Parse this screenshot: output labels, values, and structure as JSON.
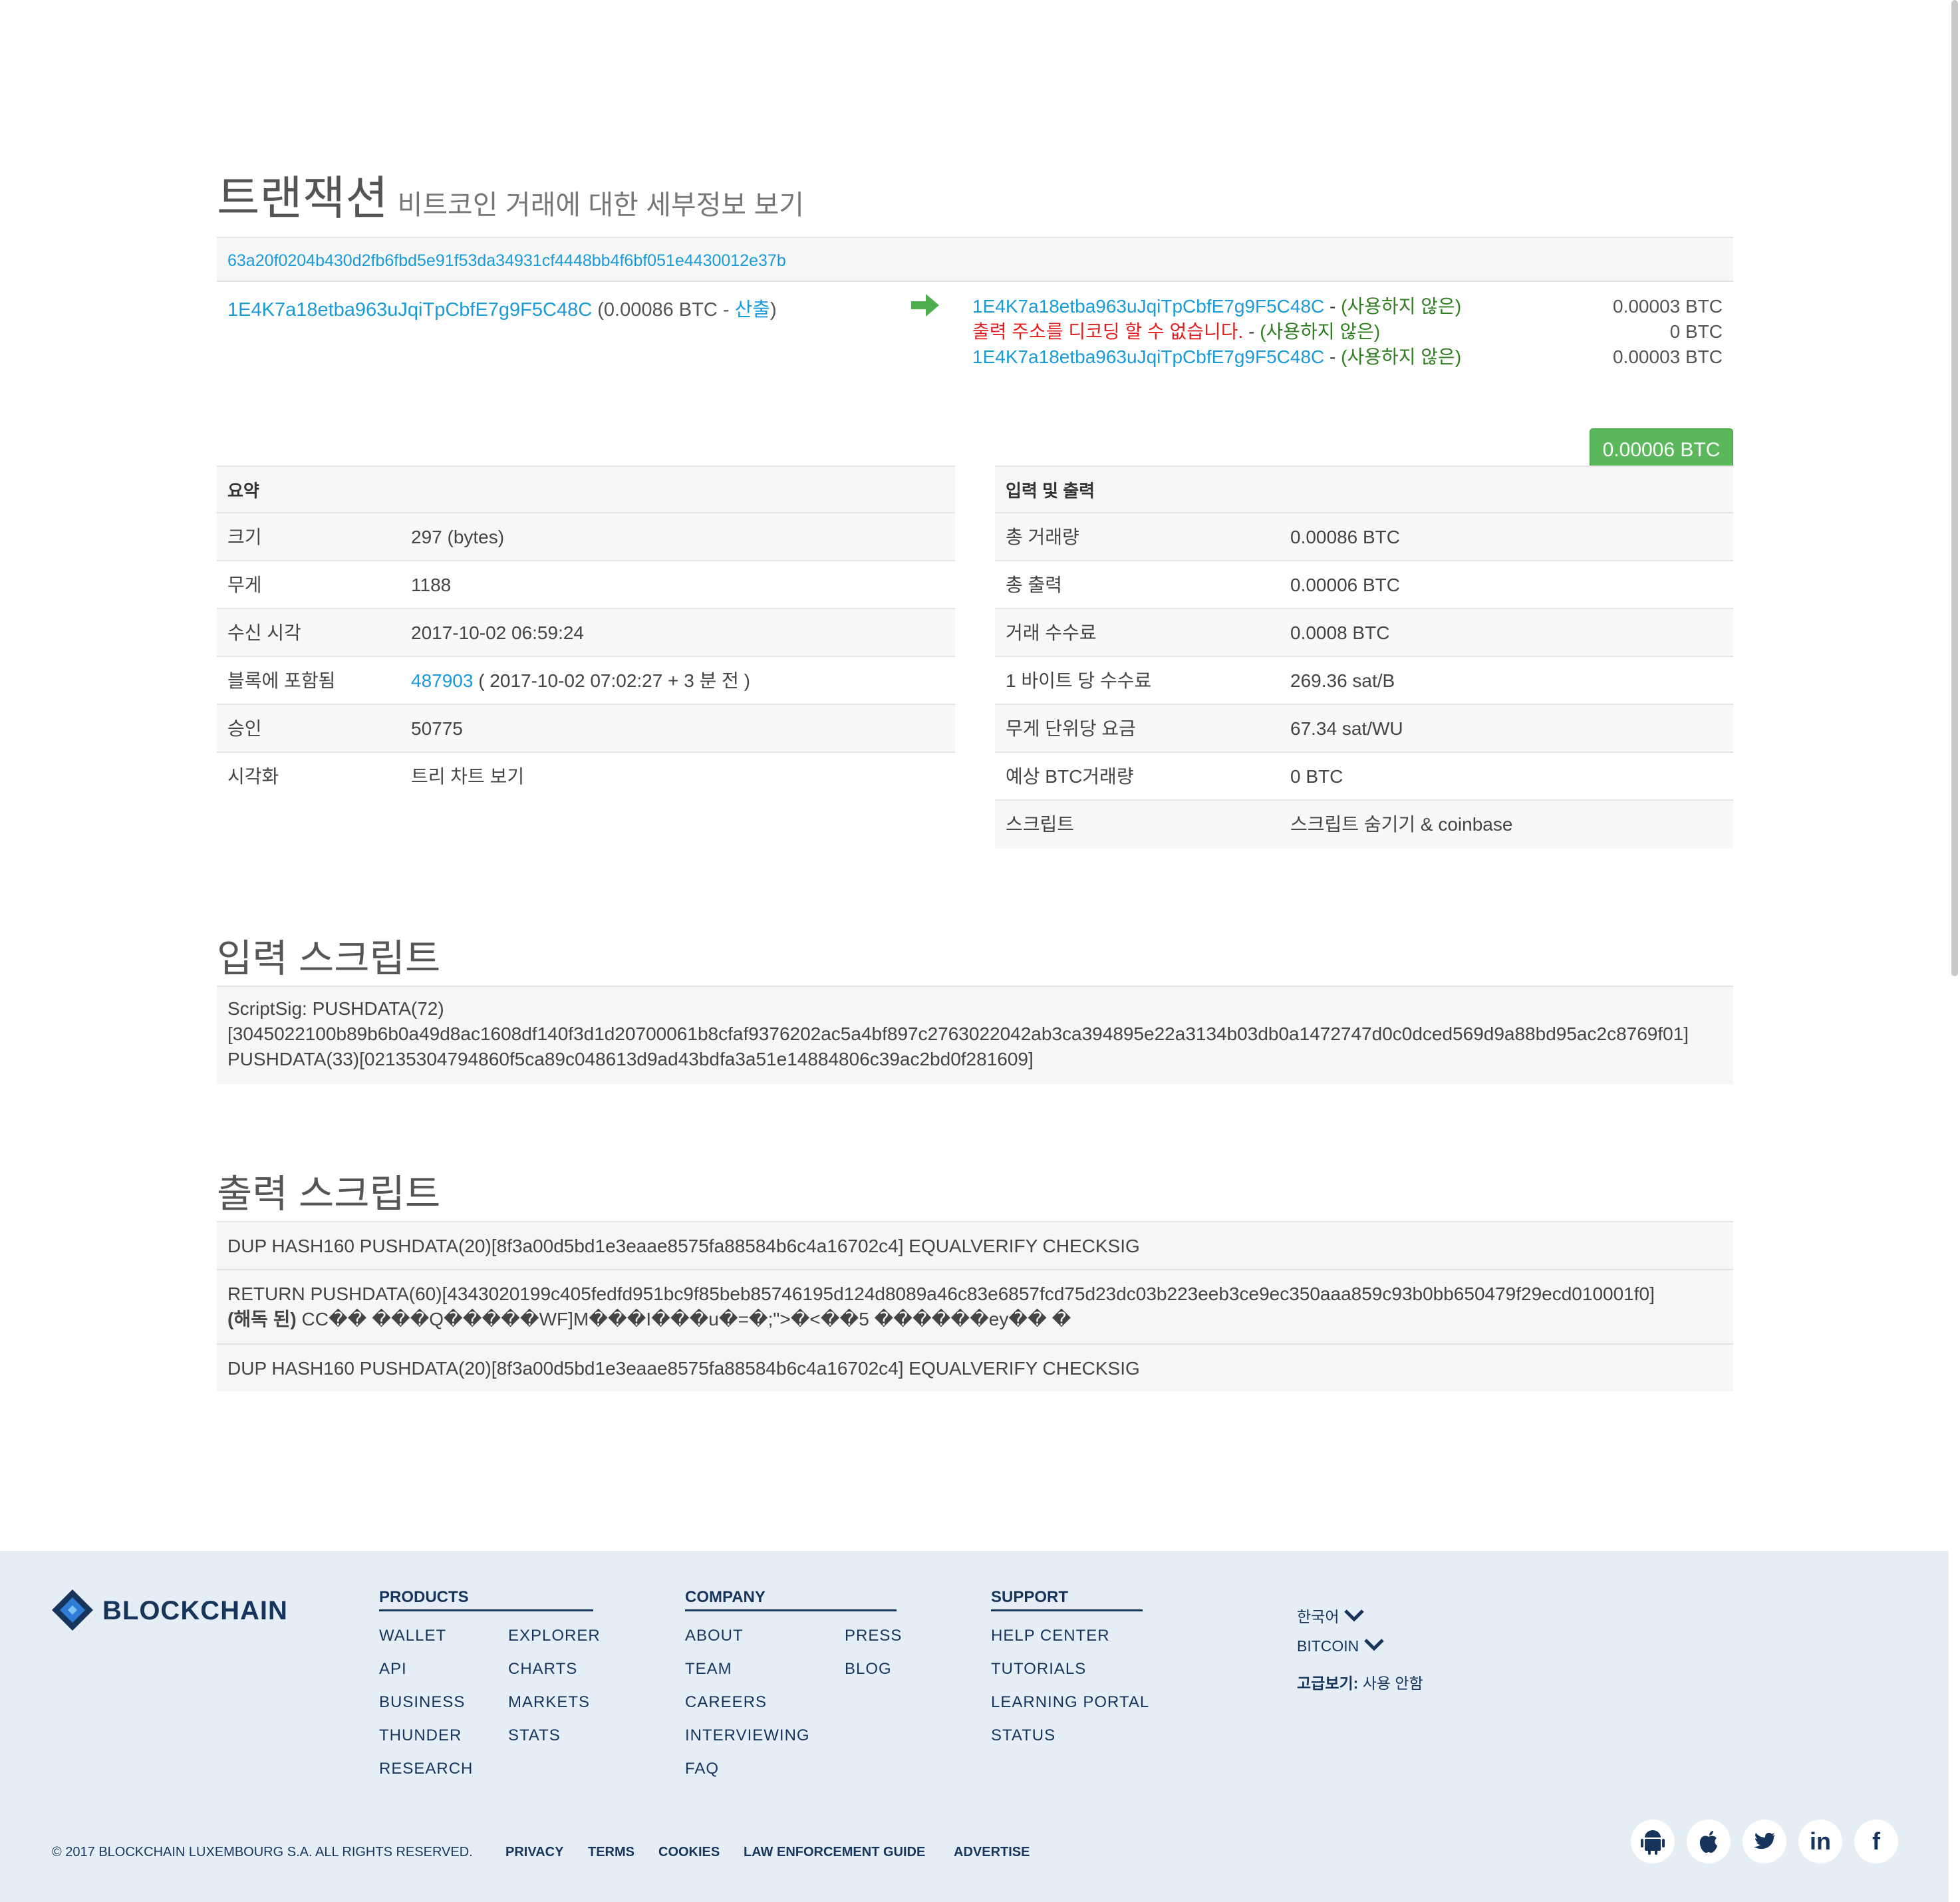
{
  "page": {
    "title": "트랜잭션",
    "subtitle": "비트코인 거래에 대한 세부정보 보기"
  },
  "tx": {
    "hash": "63a20f0204b430d2fb6fbd5e91f53da34931cf4448bb4f6bf051e4430012e37b",
    "input": {
      "address": "1E4K7a18etba963uJqiTpCbfE7g9F5C48C",
      "amount": "(0.00086 BTC - ",
      "spent_label": "산출",
      "close": ")"
    },
    "outputs": [
      {
        "address": "1E4K7a18etba963uJqiTpCbfE7g9F5C48C",
        "sep": " - ",
        "status": "(사용하지 않은)",
        "amount": "0.00003 BTC"
      },
      {
        "address": "출력 주소를 디코딩 할 수 없습니다.",
        "sep": " - ",
        "status": "(사용하지 않은)",
        "amount": "0 BTC"
      },
      {
        "address": "1E4K7a18etba963uJqiTpCbfE7g9F5C48C",
        "sep": " - ",
        "status": "(사용하지 않은)",
        "amount": "0.00003 BTC"
      }
    ],
    "total": "0.00006 BTC",
    "colors": {
      "link": "#1a9bd7",
      "unspent": "#2e7d1f",
      "error": "#e02020",
      "total_button": "#5cb85c"
    }
  },
  "summary": {
    "header": "요약",
    "rows": [
      {
        "label": "크기",
        "value": "297 (bytes)"
      },
      {
        "label": "무게",
        "value": "1188"
      },
      {
        "label": "수신 시각",
        "value": "2017-10-02 06:59:24"
      },
      {
        "label": "블록에 포함됨",
        "block": "487903",
        "value": " ( 2017-10-02 07:02:27 + 3 분 전 )"
      },
      {
        "label": "승인",
        "value": "50775"
      },
      {
        "label": "시각화",
        "value": "트리 차트 보기"
      }
    ]
  },
  "io": {
    "header": "입력 및 출력",
    "rows": [
      {
        "label": "총 거래량",
        "value": "0.00086 BTC"
      },
      {
        "label": "총 출력",
        "value": "0.00006 BTC"
      },
      {
        "label": "거래 수수료",
        "value": "0.0008 BTC"
      },
      {
        "label": "1 바이트 당 수수료",
        "value": "269.36 sat/B"
      },
      {
        "label": "무게 단위당 요금",
        "value": "67.34 sat/WU"
      },
      {
        "label": "예상 BTC거래량",
        "value": "0 BTC"
      },
      {
        "label": "스크립트",
        "value": "스크립트 숨기기 & coinbase"
      }
    ]
  },
  "input_scripts": {
    "title": "입력 스크립트",
    "lines": [
      "ScriptSig: PUSHDATA(72)",
      "[3045022100b89b6b0a49d8ac1608df140f3d1d20700061b8cfaf9376202ac5a4bf897c2763022042ab3ca394895e22a3134b03db0a1472747d0c0dced569d9a88bd95ac2c8769f01]",
      "PUSHDATA(33)[02135304794860f5ca89c048613d9ad43bdfa3a51e14884806c39ac2bd0f281609]"
    ]
  },
  "output_scripts": {
    "title": "출력 스크립트",
    "items": [
      "DUP HASH160 PUSHDATA(20)[8f3a00d5bd1e3eaae8575fa88584b6c4a16702c4] EQUALVERIFY CHECKSIG",
      "RETURN PUSHDATA(60)[4343020199c405fedfd951bc9f85beb85746195d124d8089a46c83e6857fcd75d23dc03b223eeb3ce9ec350aaa859c93b0bb650479f29ecd010001f0]",
      "DUP HASH160 PUSHDATA(20)[8f3a00d5bd1e3eaae8575fa88584b6c4a16702c4] EQUALVERIFY CHECKSIG"
    ],
    "decoded_label": "(해독 된)",
    "decoded_value": " CC�� ���Q�����WF]M���I���u�=�;\">�<��5 ������ey�� �"
  },
  "footer": {
    "brand": "BLOCKCHAIN",
    "products": {
      "title": "PRODUCTS",
      "col1": [
        "WALLET",
        "API",
        "BUSINESS",
        "THUNDER",
        "RESEARCH"
      ],
      "col2": [
        "EXPLORER",
        "CHARTS",
        "MARKETS",
        "STATS"
      ]
    },
    "company": {
      "title": "COMPANY",
      "col1": [
        "ABOUT",
        "TEAM",
        "CAREERS",
        "INTERVIEWING",
        "FAQ"
      ],
      "col2": [
        "PRESS",
        "BLOG"
      ]
    },
    "support": {
      "title": "SUPPORT",
      "items": [
        "HELP CENTER",
        "TUTORIALS",
        "LEARNING PORTAL",
        "STATUS"
      ]
    },
    "language": "한국어",
    "currency": "BITCOIN",
    "advanced_label": "고급보기:",
    "advanced_value": " 사용 안함",
    "copyright": "© 2017 BLOCKCHAIN LUXEMBOURG S.A. ALL RIGHTS RESERVED.",
    "legal_links": [
      "PRIVACY",
      "TERMS",
      "COOKIES",
      "LAW ENFORCEMENT GUIDE",
      "ADVERTISE"
    ],
    "social_icons": [
      "android-icon",
      "apple-icon",
      "twitter-icon",
      "linkedin-icon",
      "facebook-icon"
    ],
    "linkedin_text": "in",
    "facebook_text": "f",
    "brand_color": "#17355c",
    "background": "#e5eef5"
  }
}
